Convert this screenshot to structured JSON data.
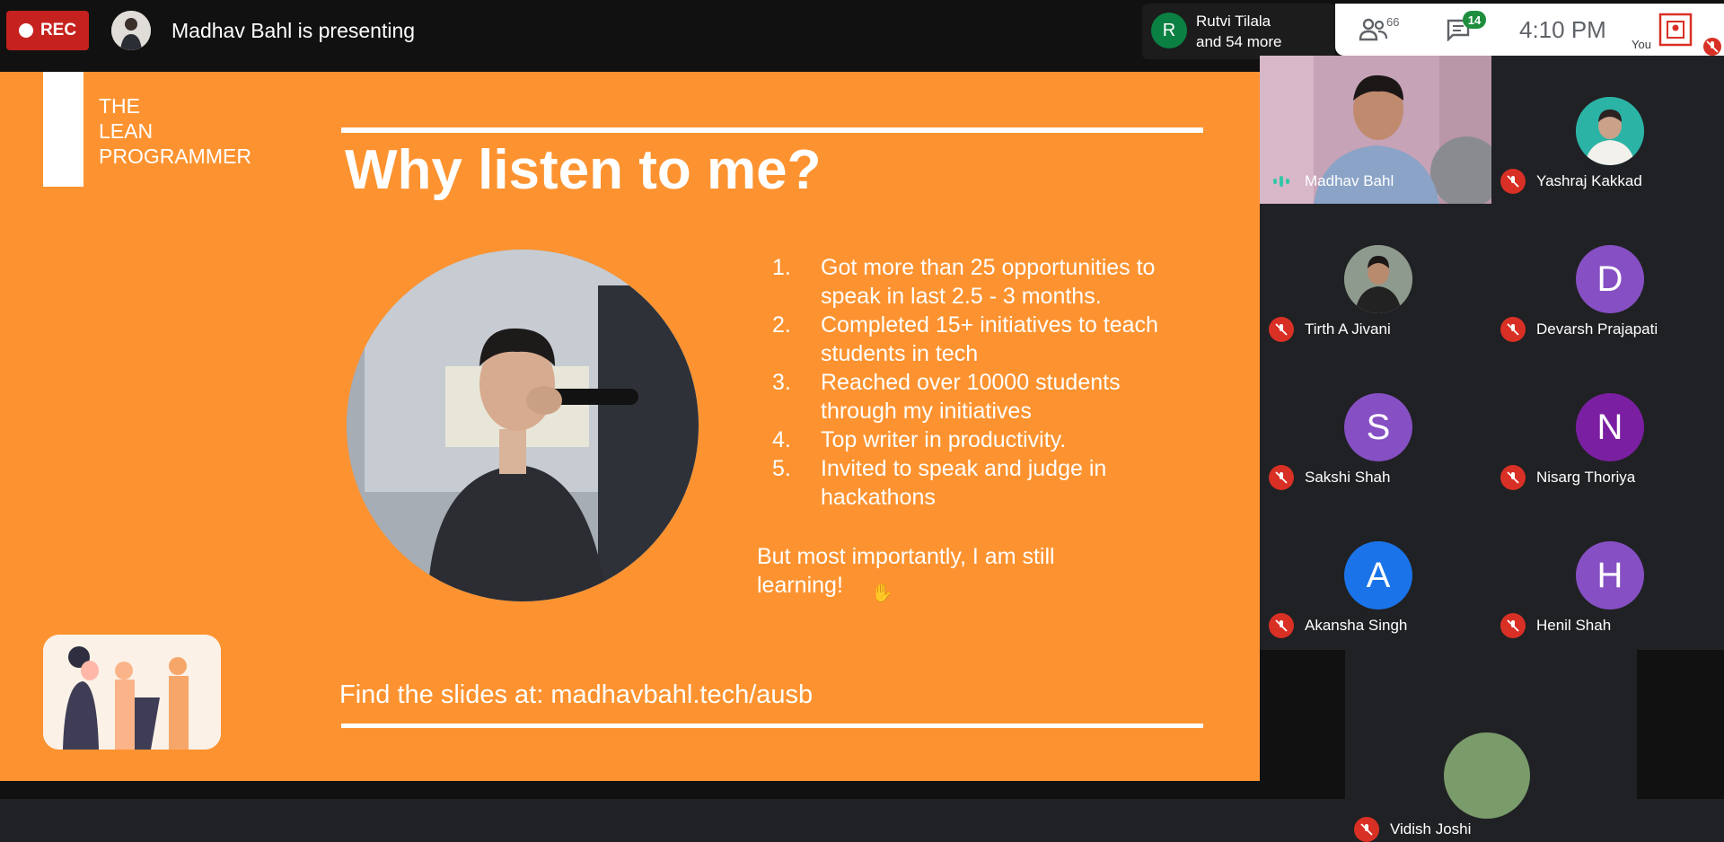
{
  "topbar": {
    "rec_label": "REC",
    "presenting_text": "Madhav Bahl is presenting",
    "recent_joiner_initial": "R",
    "recent_joiner_line1": "Rutvi Tilala",
    "recent_joiner_line2": "and 54 more",
    "people_count": "66",
    "chat_badge": "14",
    "time": "4:10  PM",
    "self_label": "You"
  },
  "slide": {
    "logo_lines": [
      "THE",
      "LEAN",
      "PROGRAMMER"
    ],
    "title": "Why listen to me?",
    "points": [
      {
        "num": "1.",
        "text": "Got more than 25 opportunities to speak in last 2.5 - 3 months."
      },
      {
        "num": "2.",
        "text": "Completed 15+ initiatives to teach students in tech"
      },
      {
        "num": "3.",
        "text": "Reached over 10000 students through my initiatives"
      },
      {
        "num": "4.",
        "text": "Top writer in productivity."
      },
      {
        "num": "5.",
        "text": "Invited to speak and judge in hackathons"
      }
    ],
    "closing": "But most importantly, I am still learning!",
    "find_slides": "Find the slides at: madhavbahl.tech/ausb"
  },
  "participants": [
    {
      "name": "Madhav Bahl",
      "type": "video",
      "speaking": true
    },
    {
      "name": "Yashraj Kakkad",
      "type": "photo",
      "muted": true
    },
    {
      "name": "Tirth A Jivani",
      "type": "photo",
      "muted": true
    },
    {
      "name": "Devarsh Prajapati",
      "initial": "D",
      "color": "#8650c4",
      "muted": true
    },
    {
      "name": "Sakshi Shah",
      "initial": "S",
      "color": "#8650c4",
      "muted": true
    },
    {
      "name": "Nisarg Thoriya",
      "initial": "N",
      "color": "#7b1fa2",
      "muted": true
    },
    {
      "name": "Akansha Singh",
      "initial": "A",
      "color": "#1a73e8",
      "muted": true
    },
    {
      "name": "Henil Shah",
      "initial": "H",
      "color": "#8650c4",
      "muted": true
    },
    {
      "name": "Vidish Joshi",
      "type": "photo",
      "muted": true
    }
  ],
  "colors": {
    "slide_bg": "#fd9330",
    "rec_red": "#c5221f",
    "mute_red": "#d93025",
    "chat_green": "#1e8e3e"
  }
}
